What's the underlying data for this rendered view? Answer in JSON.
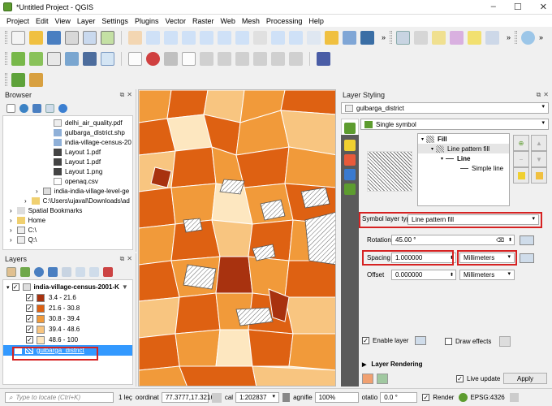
{
  "window": {
    "title": "*Untitled Project - QGIS"
  },
  "menu": [
    "Project",
    "Edit",
    "View",
    "Layer",
    "Settings",
    "Plugins",
    "Vector",
    "Raster",
    "Web",
    "Mesh",
    "Processing",
    "Help"
  ],
  "browser": {
    "title": "Browser",
    "items": [
      "delhi_air_quality.pdf",
      "gulbarga_district.shp",
      "india-village-census-20",
      "Layout 1.pdf",
      "Layout 1.pdf",
      "Layout 1.png",
      "openaq.csv",
      "india-india-village-level-ge",
      "C:\\Users\\ujaval\\Downloads\\ad",
      "Spatial Bookmarks",
      "Home",
      "C:\\",
      "Q:\\"
    ]
  },
  "layers": {
    "title": "Layers",
    "group": "india-village-census-2001-K",
    "classes": [
      {
        "label": "3.4 - 21.6",
        "color": "#a8320f"
      },
      {
        "label": "21.6 - 30.8",
        "color": "#de6112"
      },
      {
        "label": "30.8 - 39.4",
        "color": "#f19a3a"
      },
      {
        "label": "39.4 - 48.6",
        "color": "#f8c580"
      },
      {
        "label": "48.6 - 100",
        "color": "#fde7c0"
      }
    ],
    "selected": "gulbarga_district"
  },
  "styling": {
    "title": "Layer Styling",
    "layer": "gulbarga_district",
    "renderer": "Single symbol",
    "tree": [
      "Fill",
      "Line pattern fill",
      "Line",
      "Simple line"
    ],
    "symbol_layer_type_label": "Symbol layer type",
    "symbol_layer_type": "Line pattern fill",
    "rotation_label": "Rotation",
    "rotation": "45.00 °",
    "spacing_label": "Spacing",
    "spacing": "1.000000",
    "spacing_unit": "Millimeters",
    "offset_label": "Offset",
    "offset": "0.000000",
    "offset_unit": "Millimeters",
    "enable_layer": "Enable layer",
    "draw_effects": "Draw effects",
    "layer_rendering": "Layer Rendering",
    "live_update": "Live update",
    "apply": "Apply"
  },
  "status": {
    "locate_placeholder": "Type to locate (Ctrl+K)",
    "legend": "1 leç",
    "coord_label": "oordinat",
    "coord": "77.3777,17.3216",
    "scale_label": "cal",
    "scale": "1:202837",
    "magnifier_label": "agnifie",
    "magnifier": "100%",
    "rotation_label": "otatio",
    "rotation": "0.0 °",
    "render": "Render",
    "crs": "EPSG:4326"
  },
  "colors": {
    "red_highlight": "#d62222",
    "selection": "#3399ff",
    "accent": "#5d9c2f"
  }
}
